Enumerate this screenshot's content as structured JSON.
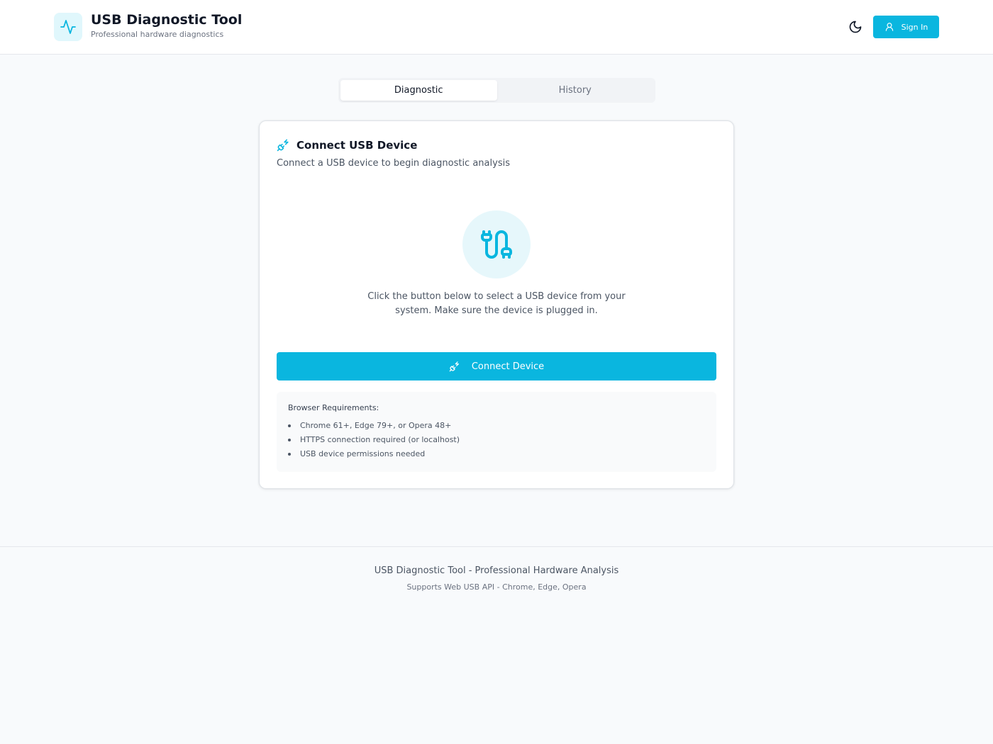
{
  "header": {
    "title": "USB Diagnostic Tool",
    "subtitle": "Professional hardware diagnostics",
    "logo_icon": "activity-icon",
    "theme_icon": "moon-icon",
    "signin_label": "Sign In",
    "signin_icon": "user-icon"
  },
  "tabs": [
    {
      "label": "Diagnostic",
      "active": true
    },
    {
      "label": "History",
      "active": false
    }
  ],
  "card": {
    "title": "Connect USB Device",
    "title_icon": "plug-zap-icon",
    "description": "Connect a USB device to begin diagnostic analysis",
    "illustration_icon": "cable-icon",
    "instructions": "Click the button below to select a USB device from your system. Make sure the device is plugged in.",
    "connect_label": "Connect Device",
    "connect_icon": "plug-zap-icon",
    "requirements": {
      "title": "Browser Requirements:",
      "items": [
        "Chrome 61+, Edge 79+, or Opera 48+",
        "HTTPS connection required (or localhost)",
        "USB device permissions needed"
      ]
    }
  },
  "footer": {
    "main": "USB Diagnostic Tool - Professional Hardware Analysis",
    "sub": "Supports Web USB API - Chrome, Edge, Opera"
  },
  "colors": {
    "accent": "#0ab6df",
    "accent_light": "#e6f7fb",
    "background": "#f8fafc"
  }
}
